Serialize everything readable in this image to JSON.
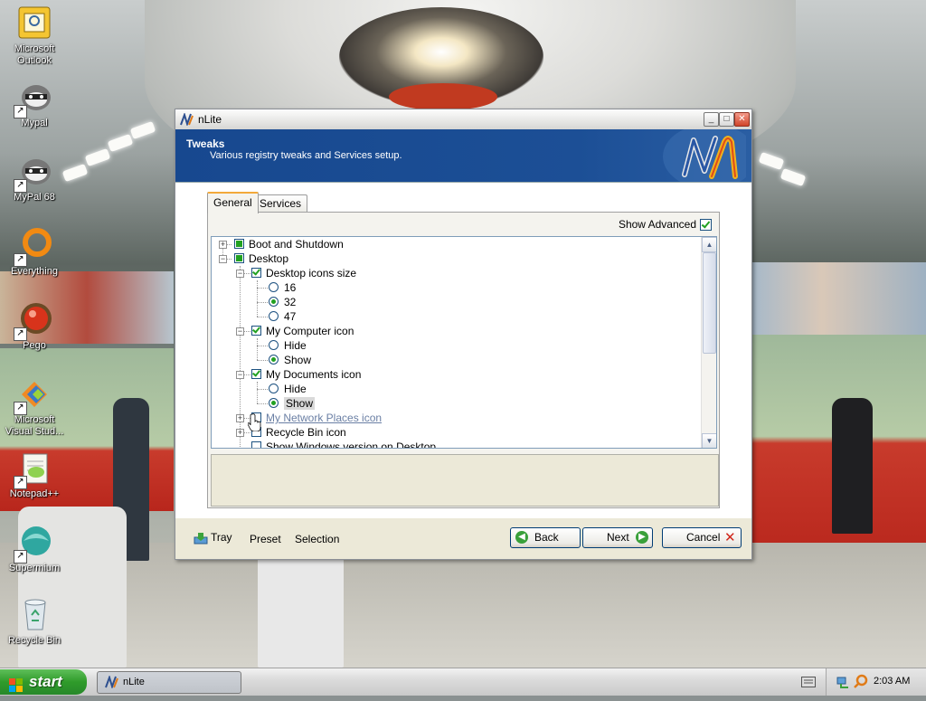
{
  "desktop": {
    "icons": [
      {
        "label": "Microsoft Outlook",
        "icon": "outlook-icon"
      },
      {
        "label": "Mypal",
        "icon": "mypal-icon"
      },
      {
        "label": "MyPal 68",
        "icon": "mypal-icon"
      },
      {
        "label": "Everything",
        "icon": "everything-icon"
      },
      {
        "label": "Pego",
        "icon": "pego-icon"
      },
      {
        "label": "Microsoft Visual Stud...",
        "icon": "visual-studio-icon"
      },
      {
        "label": "Notepad++",
        "icon": "notepad-plus-plus-icon"
      },
      {
        "label": "Supermium",
        "icon": "supermium-icon"
      },
      {
        "label": "Recycle Bin",
        "icon": "recycle-bin-icon"
      }
    ]
  },
  "window": {
    "title": "nLite",
    "header_title": "Tweaks",
    "header_subtitle": "Various registry tweaks and Services setup.",
    "tabs": [
      {
        "label": "General",
        "active": true
      },
      {
        "label": "Services",
        "active": false
      }
    ],
    "show_advanced_label": "Show Advanced",
    "show_advanced_checked": true,
    "tree": {
      "items": [
        {
          "label": "Boot and Shutdown",
          "level": 0,
          "expander": "+",
          "check": "fill"
        },
        {
          "label": "Desktop",
          "level": 0,
          "expander": "-",
          "check": "fill"
        },
        {
          "label": "Desktop icons size",
          "level": 1,
          "expander": "-",
          "check": "tick"
        },
        {
          "label": "16",
          "level": 2,
          "radio": false
        },
        {
          "label": "32",
          "level": 2,
          "radio": true
        },
        {
          "label": "47",
          "level": 2,
          "radio": false
        },
        {
          "label": "My Computer icon",
          "level": 1,
          "expander": "-",
          "check": "tick"
        },
        {
          "label": "Hide",
          "level": 2,
          "radio": false
        },
        {
          "label": "Show",
          "level": 2,
          "radio": true
        },
        {
          "label": "My Documents icon",
          "level": 1,
          "expander": "-",
          "check": "tick"
        },
        {
          "label": "Hide",
          "level": 2,
          "radio": false
        },
        {
          "label": "Show",
          "level": 2,
          "radio": true,
          "selected": true
        },
        {
          "label": "My Network Places icon",
          "level": 1,
          "expander": "+",
          "check": "none",
          "hover": true
        },
        {
          "label": "Recycle Bin icon",
          "level": 1,
          "expander": "+",
          "check": "none"
        },
        {
          "label": "Show Windows version on Desktop",
          "level": 1,
          "check": "none"
        }
      ]
    },
    "footer": {
      "tray_label": "Tray",
      "preset_label": "Preset",
      "selection_label": "Selection",
      "back_label": "Back",
      "next_label": "Next",
      "cancel_label": "Cancel"
    }
  },
  "taskbar": {
    "start_label": "start",
    "task_label": "nLite",
    "clock": "2:03 AM"
  },
  "colors": {
    "header_blue": "#1c4f96",
    "check_green": "#21a121",
    "start_green": "#2f9b2a"
  }
}
